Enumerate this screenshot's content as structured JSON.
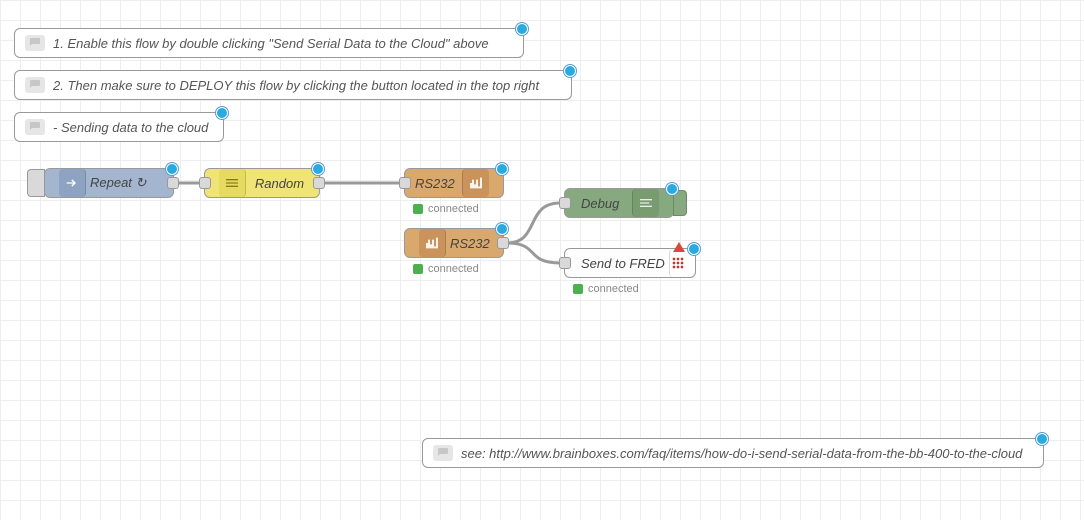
{
  "comments": {
    "c1": "1. Enable this flow by double clicking \"Send Serial Data to the Cloud\" above",
    "c2": "2. Then make sure to DEPLOY this flow by clicking the button located in the top right",
    "c3": " - Sending data to the cloud",
    "c4": "see: http://www.brainboxes.com/faq/items/how-do-i-send-serial-data-from-the-bb-400-to-the-cloud"
  },
  "nodes": {
    "repeat": {
      "label": "Repeat ↻"
    },
    "random": {
      "label": "Random"
    },
    "rs232_out": {
      "label": "RS232",
      "status": "connected"
    },
    "rs232_in": {
      "label": "RS232",
      "status": "connected"
    },
    "debug": {
      "label": "Debug"
    },
    "fred": {
      "label": "Send to FRED",
      "status": "connected"
    }
  }
}
